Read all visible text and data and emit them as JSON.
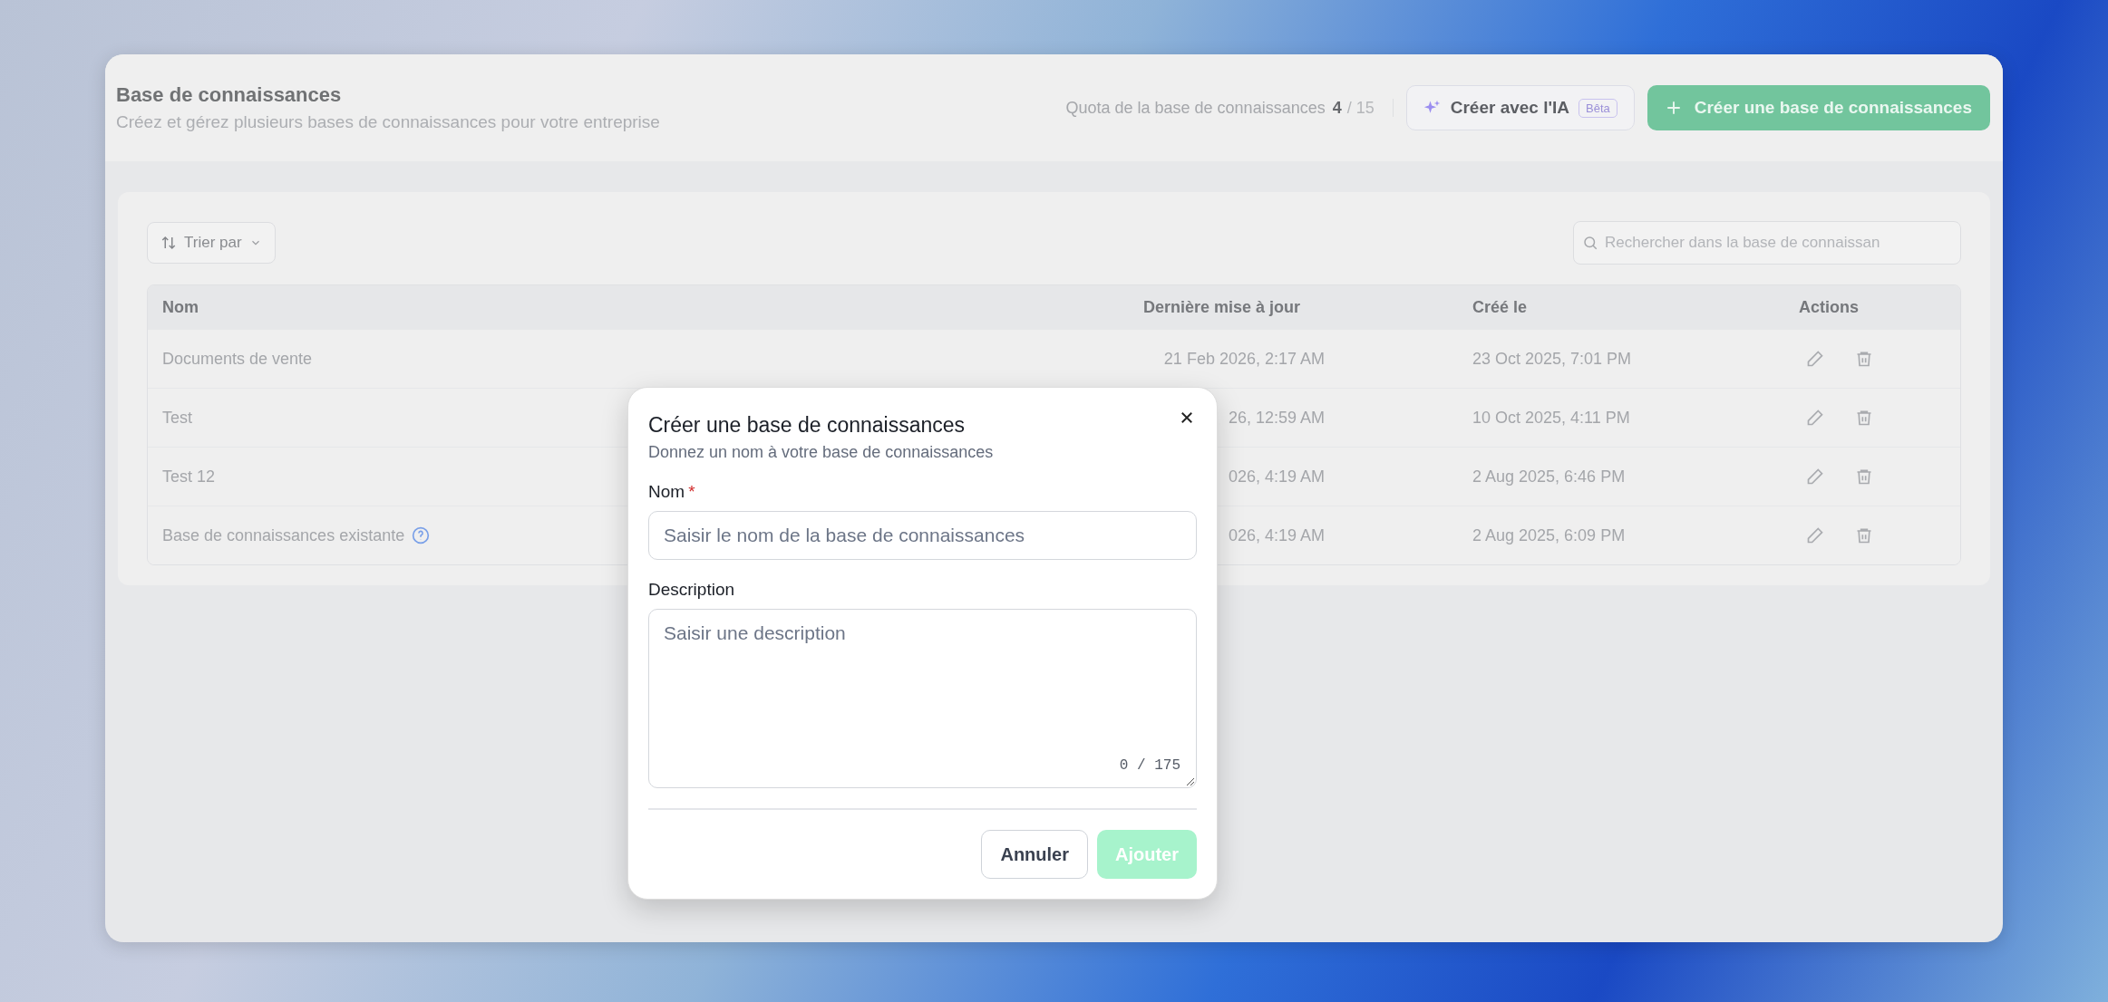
{
  "header": {
    "title": "Base de connaissances",
    "subtitle": "Créez et gérez plusieurs bases de connaissances pour votre entreprise",
    "quota": {
      "label": "Quota de la base de connaissances",
      "used": "4",
      "total": "/ 15"
    },
    "ai_button": {
      "label": "Créer avec l'IA",
      "badge": "Bêta"
    },
    "create_button": {
      "label": "Créer une base de connaissances"
    }
  },
  "toolbar": {
    "sort_button": "Trier par",
    "search": {
      "placeholder": "Rechercher dans la base de connaissan"
    }
  },
  "table": {
    "columns": [
      "Nom",
      "Dernière mise à jour",
      "Créé le",
      "Actions"
    ],
    "rows": [
      {
        "name": "Documents de vente",
        "help": false,
        "updated": "21 Feb 2026, 2:17 AM",
        "created": "23 Oct 2025, 7:01 PM"
      },
      {
        "name": "Test",
        "help": false,
        "updated": "26, 12:59 AM",
        "created": "10 Oct 2025, 4:11 PM"
      },
      {
        "name": "Test 12",
        "help": false,
        "updated": "026, 4:19 AM",
        "created": "2 Aug 2025, 6:46 PM"
      },
      {
        "name": "Base de connaissances existante",
        "help": true,
        "updated": "026, 4:19 AM",
        "created": "2 Aug 2025, 6:09 PM"
      }
    ]
  },
  "dialog": {
    "title": "Créer une base de connaissances",
    "subtitle": "Donnez un nom à votre base de connaissances",
    "fields": [
      {
        "kind": "input",
        "label": "Nom",
        "required_mark": "*",
        "placeholder": "Saisir le nom de la base de connaissances"
      },
      {
        "kind": "textarea",
        "label": "Description",
        "placeholder": "Saisir une description",
        "counter": "0 / 175"
      }
    ],
    "buttons": [
      {
        "label": "Annuler",
        "kind": "secondary",
        "disabled": false
      },
      {
        "label": "Ajouter",
        "kind": "primary",
        "disabled": true
      }
    ]
  }
}
